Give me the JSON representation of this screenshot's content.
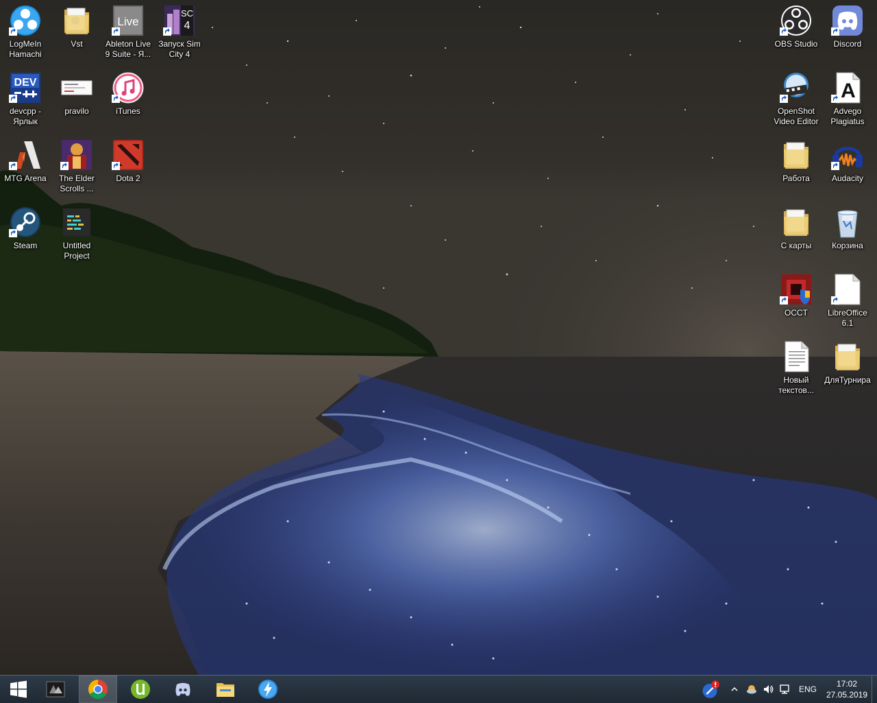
{
  "desktop": {
    "icons_left": [
      {
        "label": "LogMeIn Hamachi",
        "icon": "hamachi-icon",
        "shortcut": true
      },
      {
        "label": "Vst",
        "icon": "folder-icon",
        "shortcut": false
      },
      {
        "label": "Ableton Live 9 Suite - Я...",
        "icon": "ableton-live-icon",
        "shortcut": true
      },
      {
        "label": "Запуск Sim City 4",
        "icon": "simcity4-icon",
        "shortcut": true
      },
      {
        "label": "devcpp - Ярлык",
        "icon": "devcpp-icon",
        "shortcut": true
      },
      {
        "label": "pravilo",
        "icon": "image-file-icon",
        "shortcut": false
      },
      {
        "label": "iTunes",
        "icon": "itunes-icon",
        "shortcut": true
      },
      {
        "label": "MTG Arena",
        "icon": "mtg-arena-icon",
        "shortcut": true
      },
      {
        "label": "The Elder Scrolls ...",
        "icon": "elder-scrolls-icon",
        "shortcut": true
      },
      {
        "label": "Dota 2",
        "icon": "dota2-icon",
        "shortcut": true
      },
      {
        "label": "Steam",
        "icon": "steam-icon",
        "shortcut": true
      },
      {
        "label": "Untitled Project",
        "icon": "project-file-icon",
        "shortcut": false
      }
    ],
    "icons_right": [
      {
        "label": "OBS Studio",
        "icon": "obs-studio-icon",
        "shortcut": true
      },
      {
        "label": "Discord",
        "icon": "discord-icon",
        "shortcut": true
      },
      {
        "label": "OpenShot Video Editor",
        "icon": "openshot-icon",
        "shortcut": true
      },
      {
        "label": "Advego Plagiatus",
        "icon": "advego-icon",
        "shortcut": true
      },
      {
        "label": "Работа",
        "icon": "folder-icon",
        "shortcut": false
      },
      {
        "label": "Audacity",
        "icon": "audacity-icon",
        "shortcut": true
      },
      {
        "label": "С карты",
        "icon": "folder-icon",
        "shortcut": false
      },
      {
        "label": "Корзина",
        "icon": "recycle-bin-icon",
        "shortcut": false
      },
      {
        "label": "OCCT",
        "icon": "occt-icon",
        "shortcut": true
      },
      {
        "label": "LibreOffice 6.1",
        "icon": "libreoffice-icon",
        "shortcut": true
      },
      {
        "label": "Новый текстов...",
        "icon": "text-file-icon",
        "shortcut": false
      },
      {
        "label": "ДляТурнира",
        "icon": "folder-icon",
        "shortcut": false
      }
    ]
  },
  "taskbar": {
    "pinned": [
      {
        "name": "start-button",
        "icon": "windows-logo-icon",
        "active": false
      },
      {
        "name": "nvidia-geforce-experience",
        "icon": "nvidia-icon",
        "active": false
      },
      {
        "name": "google-chrome",
        "icon": "chrome-icon",
        "active": true
      },
      {
        "name": "utorrent",
        "icon": "utorrent-icon",
        "active": false
      },
      {
        "name": "discord",
        "icon": "discord-icon",
        "active": false
      },
      {
        "name": "file-explorer",
        "icon": "file-explorer-icon",
        "active": false
      },
      {
        "name": "fast-app",
        "icon": "lightning-icon",
        "active": false
      }
    ],
    "tray": {
      "language": "ENG",
      "time": "17:02",
      "date": "27.05.2019"
    }
  }
}
